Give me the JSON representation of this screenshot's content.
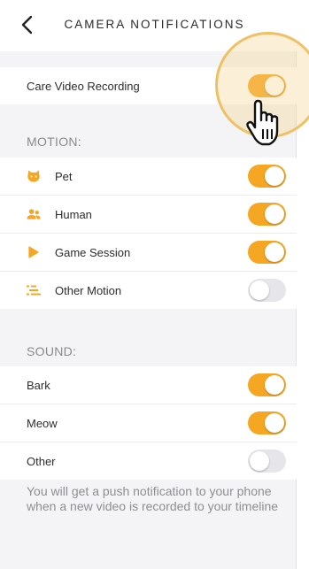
{
  "header": {
    "title": "CAMERA NOTIFICATIONS"
  },
  "care_video": {
    "label": "Care Video Recording",
    "enabled": true
  },
  "motion": {
    "section_label": "MOTION:",
    "items": [
      {
        "label": "Pet",
        "icon": "pet-icon",
        "enabled": true
      },
      {
        "label": "Human",
        "icon": "human-icon",
        "enabled": true
      },
      {
        "label": "Game Session",
        "icon": "play-icon",
        "enabled": true
      },
      {
        "label": "Other Motion",
        "icon": "motion-lines-icon",
        "enabled": false
      }
    ]
  },
  "sound": {
    "section_label": "SOUND:",
    "items": [
      {
        "label": "Bark",
        "enabled": true
      },
      {
        "label": "Meow",
        "enabled": true
      },
      {
        "label": "Other",
        "enabled": false
      }
    ]
  },
  "footer_note": "You will get a push notification to your phone when a new video is recorded to your timeline",
  "colors": {
    "accent": "#f5a623",
    "toggle_off": "#e6e6ea",
    "section_text": "#8a8a8e"
  }
}
